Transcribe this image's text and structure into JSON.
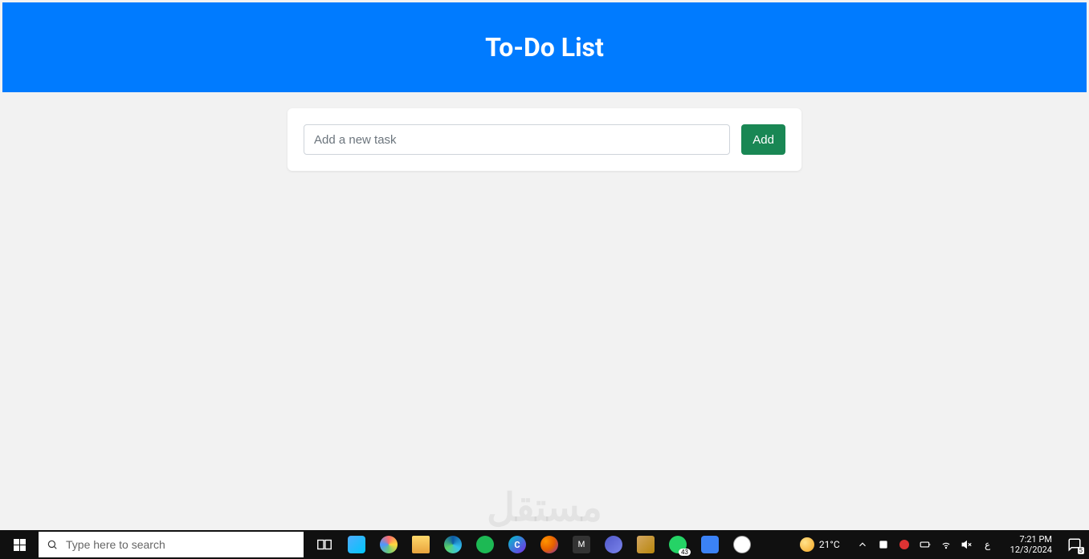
{
  "app": {
    "title": "To-Do List",
    "input_placeholder": "Add a new task",
    "add_button_label": "Add"
  },
  "watermark": "مستقل",
  "taskbar": {
    "search_placeholder": "Type here to search",
    "weather_temp": "21°C",
    "language_indicator": "ع",
    "time": "7:21 PM",
    "date": "12/3/2024",
    "notification_count": "5",
    "news_badge": "43"
  }
}
